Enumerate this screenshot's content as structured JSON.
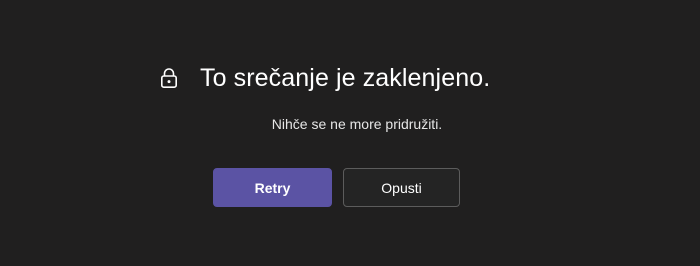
{
  "dialog": {
    "title": "To srečanje je zaklenjeno.",
    "message": "Nihče se ne more pridružiti.",
    "lock_icon": "lock-icon"
  },
  "actions": {
    "primary_label": "Retry",
    "secondary_label": "Opusti"
  },
  "colors": {
    "background": "#201f1f",
    "primary_button": "#5b53a4",
    "secondary_button": "#242424",
    "secondary_border": "#5c5c5c",
    "text": "#ffffff"
  }
}
